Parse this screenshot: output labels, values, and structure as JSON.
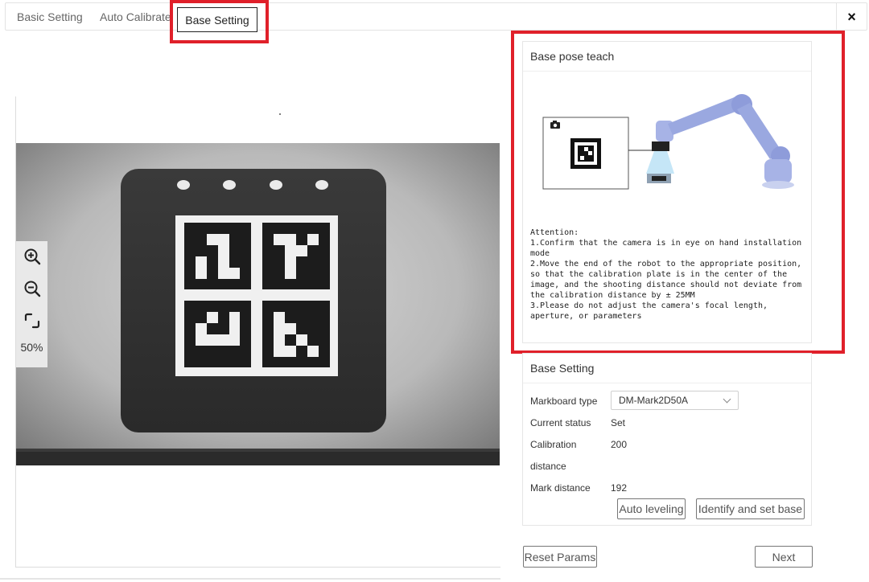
{
  "tabs": [
    {
      "label": "Basic Setting"
    },
    {
      "label": "Auto Calibrate"
    },
    {
      "label": "Base Setting"
    }
  ],
  "close_label": "×",
  "viewer": {
    "zoom_percent": "50%"
  },
  "base_pose_teach": {
    "title": "Base pose teach",
    "attention": "Attention:\n1.Confirm that the camera is in eye on hand installation mode\n2.Move the end of the robot to the appropriate position, so that the calibration plate is in the center of the image, and the shooting distance should not deviate from the calibration distance by ± 25MM\n3.Please do not adjust the camera's focal length, aperture, or parameters"
  },
  "base_setting": {
    "title": "Base Setting",
    "markboard_type_label": "Markboard type",
    "markboard_type_value": "DM-Mark2D50A",
    "current_status_label": "Current status",
    "current_status_value": "Set",
    "calibration_label_line1": "Calibration",
    "calibration_label_line2": "distance",
    "calibration_value": "200",
    "mark_distance_label": "Mark distance",
    "mark_distance_value": "192",
    "auto_leveling_label": "Auto leveling",
    "identify_label": "Identify and set base"
  },
  "footer": {
    "reset_label": "Reset Params",
    "next_label": "Next"
  },
  "colors": {
    "highlight": "#e0202a",
    "robot": "#9aa8e0"
  }
}
